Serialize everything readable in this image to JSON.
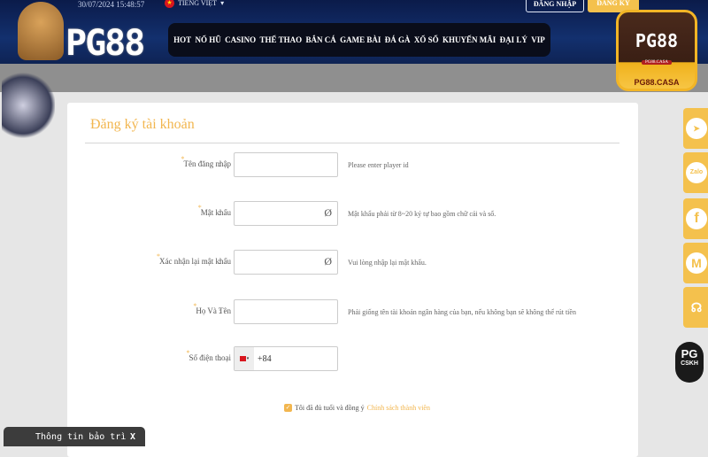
{
  "header": {
    "datetime": "30/07/2024 15:48:57",
    "language": "TIẾNG VIỆT",
    "login_label": "ĐĂNG NHẬP",
    "register_label": "ĐĂNG KÝ",
    "logo": "PG88",
    "nav": [
      "HOT",
      "NỔ HŨ",
      "CASINO",
      "THỂ THAO",
      "BẮN CÁ",
      "GAME BÀI",
      "ĐÁ GÀ",
      "XỔ SỐ",
      "KHUYẾN MÃI",
      "ĐẠI LÝ",
      "VIP"
    ]
  },
  "brand_badge": {
    "logo": "PG88",
    "sub": "PG88.CASA",
    "domain": "PG88.CASA"
  },
  "form": {
    "title": "Đăng ký tài khoản",
    "colon": ":",
    "fields": [
      {
        "label": "Tên đăng nhập",
        "value": "",
        "hint": "Please enter player id"
      },
      {
        "label": "Mật khẩu",
        "value": "",
        "hint": "Mật khẩu phải từ 8~20 ký tự bao gồm chữ cái và số."
      },
      {
        "label": "Xác nhận lại mật khẩu",
        "value": "",
        "hint": "Vui lòng nhập lại mật khẩu."
      },
      {
        "label": "Họ Và Tên",
        "value": "",
        "hint": "Phải giống tên tài khoản ngân hàng của bạn, nếu không bạn sẽ không thể rút tiền"
      },
      {
        "label": "Số điện thoại",
        "value": "+84"
      }
    ],
    "agree_text": "Tôi đã đủ tuổi và đồng ý",
    "agree_link": "Chính sách thành viên",
    "agree_checked": true
  },
  "sidebar": {
    "items": [
      {
        "icon": "telegram-icon"
      },
      {
        "icon": "zalo-icon",
        "label": "Zalo"
      },
      {
        "icon": "facebook-icon",
        "label": "f"
      },
      {
        "icon": "gmail-icon",
        "label": "M"
      },
      {
        "icon": "support-icon"
      }
    ],
    "cskh_logo": "PG",
    "cskh_label": "CSKH"
  },
  "maintenance": {
    "title": "Thông tin bảo trì",
    "close": "X"
  },
  "colors": {
    "accent": "#f4c14d",
    "header": "#13306e"
  }
}
